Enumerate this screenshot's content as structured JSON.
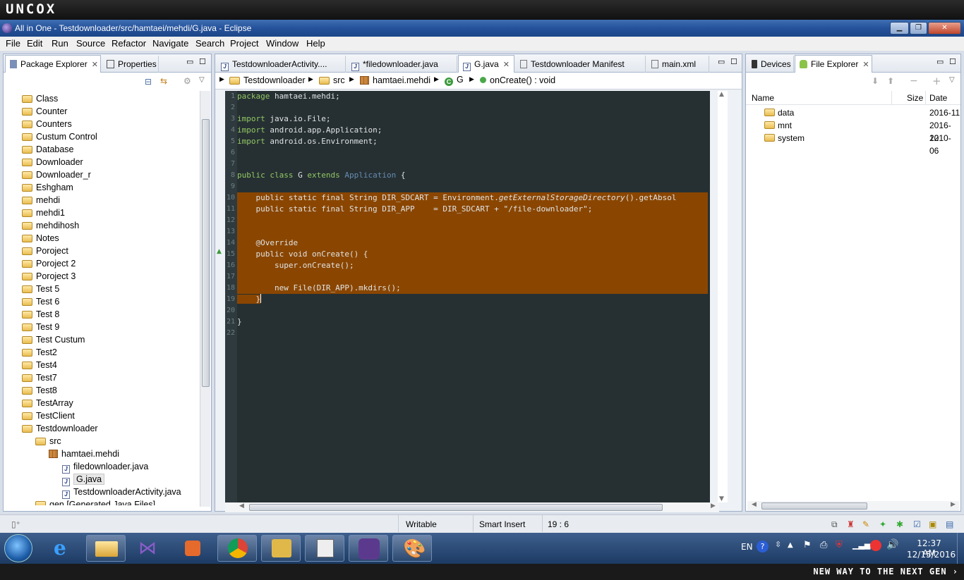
{
  "brand": "UNCOX",
  "window": {
    "title": "All in One - Testdownloader/src/hamtaei/mehdi/G.java - Eclipse"
  },
  "menu": [
    "File",
    "Edit",
    "Run",
    "Source",
    "Refactor",
    "Navigate",
    "Search",
    "Project",
    "Window",
    "Help"
  ],
  "left_panel": {
    "tabs": [
      "Package Explorer",
      "Properties"
    ],
    "tree": [
      {
        "label": "Class",
        "depth": 0,
        "icon": "folder"
      },
      {
        "label": "Counter",
        "depth": 0,
        "icon": "folder"
      },
      {
        "label": "Counters",
        "depth": 0,
        "icon": "folder"
      },
      {
        "label": "Custum Control",
        "depth": 0,
        "icon": "folder"
      },
      {
        "label": "Database",
        "depth": 0,
        "icon": "folder"
      },
      {
        "label": "Downloader",
        "depth": 0,
        "icon": "folder"
      },
      {
        "label": "Downloader_r",
        "depth": 0,
        "icon": "folder"
      },
      {
        "label": "Eshgham",
        "depth": 0,
        "icon": "folder"
      },
      {
        "label": "mehdi",
        "depth": 0,
        "icon": "folder"
      },
      {
        "label": "mehdi1",
        "depth": 0,
        "icon": "folder"
      },
      {
        "label": "mehdihosh",
        "depth": 0,
        "icon": "folder"
      },
      {
        "label": "Notes",
        "depth": 0,
        "icon": "folder"
      },
      {
        "label": "Poroject",
        "depth": 0,
        "icon": "folder"
      },
      {
        "label": "Poroject 2",
        "depth": 0,
        "icon": "folder"
      },
      {
        "label": "Poroject 3",
        "depth": 0,
        "icon": "folder"
      },
      {
        "label": "Test 5",
        "depth": 0,
        "icon": "folder"
      },
      {
        "label": "Test 6",
        "depth": 0,
        "icon": "folder"
      },
      {
        "label": "Test 8",
        "depth": 0,
        "icon": "folder"
      },
      {
        "label": "Test 9",
        "depth": 0,
        "icon": "folder"
      },
      {
        "label": "Test Custum",
        "depth": 0,
        "icon": "folder"
      },
      {
        "label": "Test2",
        "depth": 0,
        "icon": "folder"
      },
      {
        "label": "Test4",
        "depth": 0,
        "icon": "folder"
      },
      {
        "label": "Test7",
        "depth": 0,
        "icon": "folder"
      },
      {
        "label": "Test8",
        "depth": 0,
        "icon": "folder"
      },
      {
        "label": "TestArray",
        "depth": 0,
        "icon": "folder"
      },
      {
        "label": "TestClient",
        "depth": 0,
        "icon": "folder"
      },
      {
        "label": "Testdownloader",
        "depth": 0,
        "icon": "folder"
      },
      {
        "label": "src",
        "depth": 1,
        "icon": "folder"
      },
      {
        "label": "hamtaei.mehdi",
        "depth": 2,
        "icon": "pkg"
      },
      {
        "label": "filedownloader.java",
        "depth": 3,
        "icon": "java"
      },
      {
        "label": "G.java",
        "depth": 3,
        "icon": "java",
        "selected": true
      },
      {
        "label": "TestdownloaderActivity.java",
        "depth": 3,
        "icon": "java"
      },
      {
        "label": "gen [Generated Java Files]",
        "depth": 1,
        "icon": "folder"
      }
    ]
  },
  "editor": {
    "tabs": [
      "TestdownloaderActivity....",
      "*filedownloader.java",
      "G.java",
      "Testdownloader Manifest",
      "main.xml"
    ],
    "active_tab": 2,
    "breadcrumb": [
      "Testdownloader",
      "src",
      "hamtaei.mehdi",
      "G",
      "onCreate() : void"
    ],
    "lines": [
      {
        "n": "1",
        "code": "<span class='kw'>package</span> hamtaei.mehdi;",
        "hl": false
      },
      {
        "n": "2",
        "code": "",
        "hl": false
      },
      {
        "n": "3",
        "code": "<span class='kw'>import</span> java.io.File;",
        "hl": false
      },
      {
        "n": "4",
        "code": "<span class='kw'>import</span> android.app.Application;",
        "hl": false
      },
      {
        "n": "5",
        "code": "<span class='kw'>import</span> android.os.Environment;",
        "hl": false
      },
      {
        "n": "6",
        "code": "",
        "hl": false
      },
      {
        "n": "7",
        "code": "",
        "hl": false
      },
      {
        "n": "8",
        "code": "<span class='kw'>public class</span> G <span class='kw'>extends</span> <span class='ty'>Application</span> {",
        "hl": false
      },
      {
        "n": "9",
        "code": "",
        "hl": false
      },
      {
        "n": "10",
        "code": "    public static final String DIR_SDCART = Environment.<span class='it'>getExternalStorageDirectory</span>().getAbsol",
        "hl": true
      },
      {
        "n": "11",
        "code": "    public static final String DIR_APP    = DIR_SDCART + \"/file-downloader\";",
        "hl": true
      },
      {
        "n": "12",
        "code": "",
        "hl": true
      },
      {
        "n": "13",
        "code": "",
        "hl": true
      },
      {
        "n": "14",
        "code": "    @Override",
        "hl": true
      },
      {
        "n": "15",
        "code": "    public void onCreate() {",
        "hl": true
      },
      {
        "n": "16",
        "code": "        super.onCreate();",
        "hl": true
      },
      {
        "n": "17",
        "code": "",
        "hl": true
      },
      {
        "n": "18",
        "code": "        new File(DIR_APP).mkdirs();",
        "hl": true
      },
      {
        "n": "19",
        "code": "    }",
        "hl": "partial"
      },
      {
        "n": "20",
        "code": "",
        "hl": false
      },
      {
        "n": "21",
        "code": "}",
        "hl": false
      },
      {
        "n": "22",
        "code": "",
        "hl": false
      }
    ]
  },
  "right_panel": {
    "tabs": [
      "Devices",
      "File Explorer"
    ],
    "columns": [
      "Name",
      "Size",
      "Date"
    ],
    "rows": [
      {
        "name": "data",
        "size": "",
        "date": "2016-11"
      },
      {
        "name": "mnt",
        "size": "",
        "date": "2016-12"
      },
      {
        "name": "system",
        "size": "",
        "date": "2010-06"
      }
    ]
  },
  "status": {
    "mode": "Writable",
    "insert": "Smart Insert",
    "position": "19 : 6"
  },
  "taskbar": {
    "lang": "EN",
    "time": "12:37 AM",
    "date": "12/15/2016"
  },
  "tagline": "NEW WAY TO THE NEXT GEN ›",
  "colors": {
    "code_bg": "#263033",
    "highlight": "#8a4600",
    "keyword": "#93c763"
  }
}
